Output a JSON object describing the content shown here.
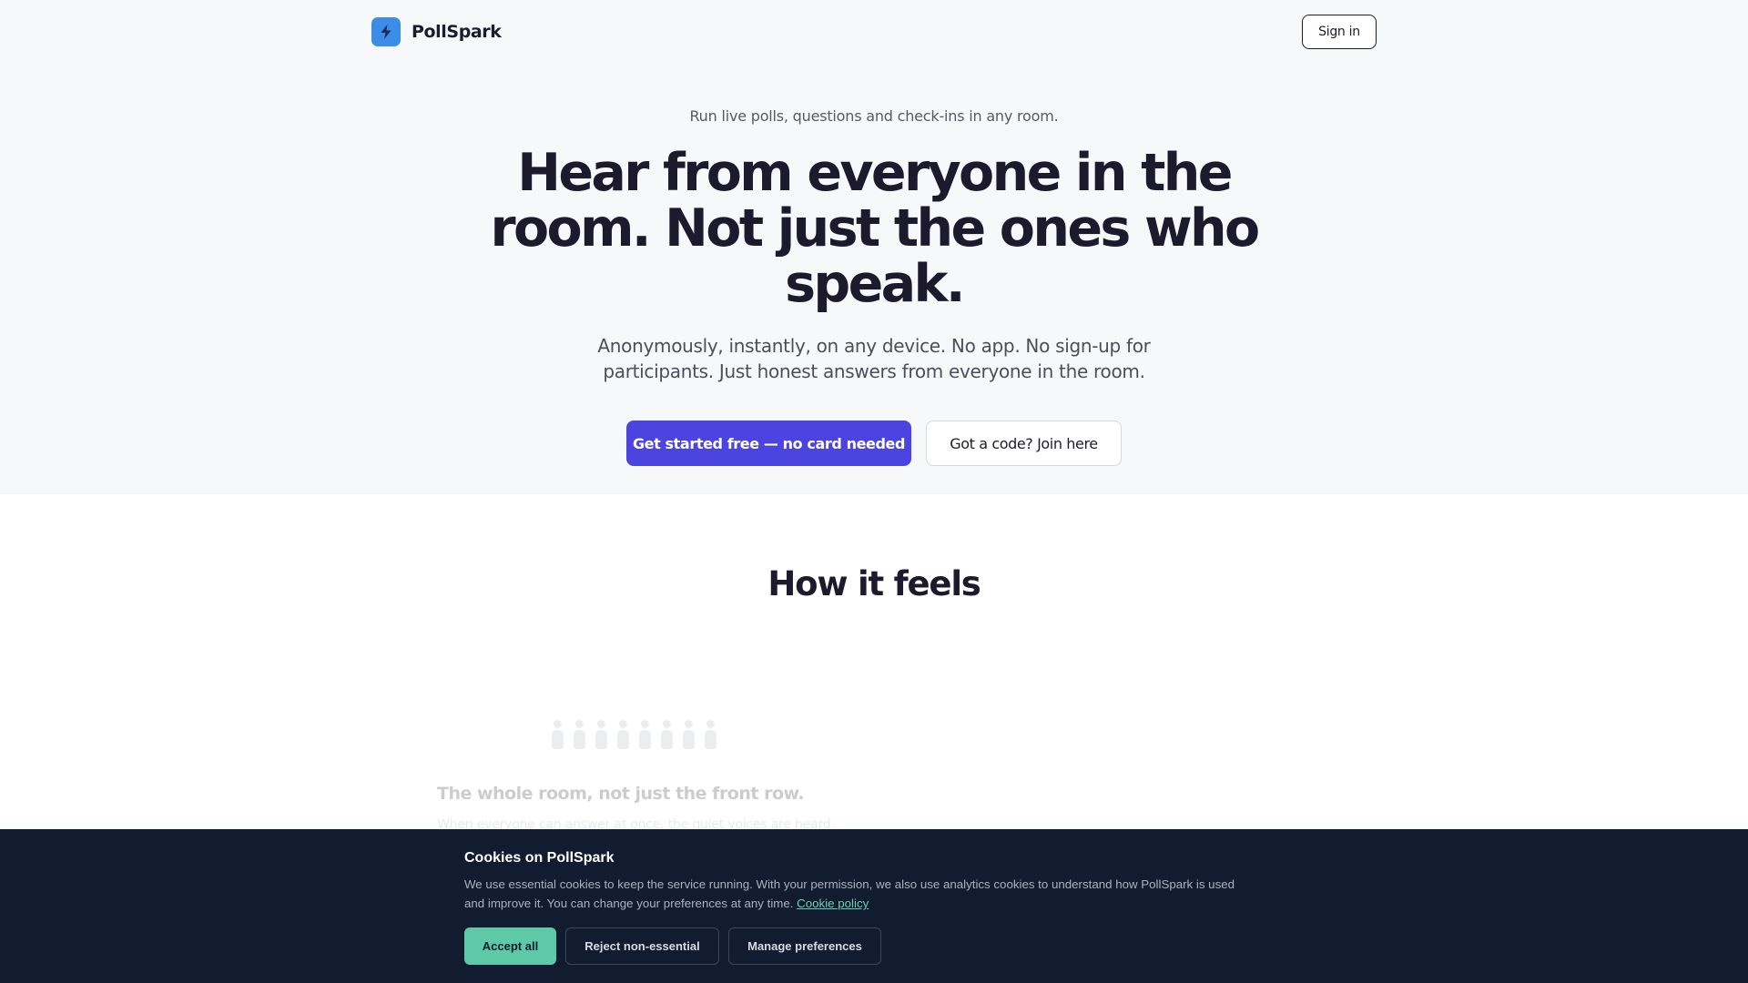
{
  "header": {
    "brand_name": "PollSpark",
    "logo_icon": "lightning-bolt-icon",
    "signin_label": "Sign in"
  },
  "hero": {
    "eyebrow": "Run live polls, questions and check-ins in any room.",
    "headline": "Hear from everyone in the room. Not just the ones who speak.",
    "subhead": "Anonymously, instantly, on any device. No app. No sign-up for participants. Just honest answers from everyone in the room.",
    "primary_cta": "Get started free — no card needed",
    "secondary_cta": "Got a code? Join here"
  },
  "how_it_feels": {
    "title": "How it feels",
    "feature_icon": "people-group-icon",
    "feature_title": "The whole room, not just the front row.",
    "feature_text": "When everyone can answer at once, the quiet voices are heard."
  },
  "cookie_banner": {
    "title": "Cookies on PollSpark",
    "text": "We use essential cookies to keep the service running. With your permission, we also use analytics cookies to understand how PollSpark is used and improve it. You can change your preferences at any time.",
    "policy_link": "Cookie policy",
    "accept_label": "Accept all",
    "reject_label": "Reject non-essential",
    "manage_label": "Manage preferences"
  },
  "colors": {
    "brand_primary": "#4b44e0",
    "logo_blue": "#3b8de8",
    "cookie_bg": "#121c30",
    "accept_green": "#5ec9a6",
    "hero_bg": "#f7f8fa"
  }
}
